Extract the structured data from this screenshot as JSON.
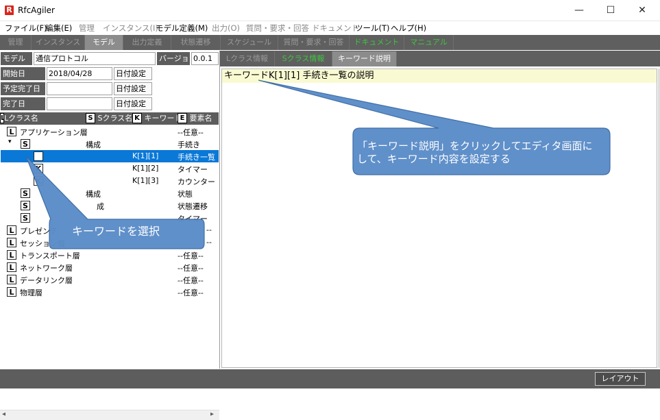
{
  "window": {
    "title": "RfcAgiler",
    "logo_letter": "R",
    "minimize": "—",
    "maximize": "☐",
    "close": "✕"
  },
  "menu": [
    {
      "label": "ファイル(F)",
      "enabled": true
    },
    {
      "label": "編集(E)",
      "enabled": true
    },
    {
      "label": "管理",
      "enabled": false
    },
    {
      "label": "インスタンス(I)",
      "enabled": false
    },
    {
      "label": "モデル定義(M)",
      "enabled": true
    },
    {
      "label": "出力(O)",
      "enabled": false
    },
    {
      "label": "質問・要求・回答",
      "enabled": false
    },
    {
      "label": "ドキュメント",
      "enabled": false
    },
    {
      "label": "ツール(T)",
      "enabled": true
    },
    {
      "label": "ヘルプ(H)",
      "enabled": true
    }
  ],
  "main_tabs": [
    {
      "label": "管理",
      "state": "normal"
    },
    {
      "label": "インスタンス",
      "state": "normal"
    },
    {
      "label": "モデル",
      "state": "active"
    },
    {
      "label": "出力定義",
      "state": "normal"
    },
    {
      "label": "状態遷移",
      "state": "normal"
    },
    {
      "label": "スケジュール",
      "state": "normal"
    },
    {
      "label": "質問・要求・回答",
      "state": "normal"
    },
    {
      "label": "ドキュメント",
      "state": "green"
    },
    {
      "label": "マニュアル",
      "state": "green"
    }
  ],
  "model_form": {
    "model_name_label": "モデル名",
    "model_name_value": "通信プロトコル",
    "version_label": "バージョン",
    "version_value": "0.0.1",
    "start_label": "開始日",
    "start_value": "2018/04/28",
    "planned_label": "予定完了日",
    "planned_value": "",
    "done_label": "完了日",
    "done_value": "",
    "date_button": "日付設定"
  },
  "tree_header": {
    "l_badge": "L",
    "l_label": "Lクラス名",
    "s_badge": "S",
    "s_label": "Sクラス名",
    "k_badge": "K",
    "k_label": "キーワード",
    "e_badge": "E",
    "e_label": "要素名"
  },
  "tree_rows": [
    {
      "badge": "L",
      "name": "アプリケーション層",
      "sclass": "",
      "keyword": "",
      "element": "--任意--",
      "selected": false
    },
    {
      "badge": "S",
      "expander": "▾",
      "name": "",
      "sclass": "構成",
      "keyword": "",
      "element": "手続き",
      "selected": false
    },
    {
      "badge": "K",
      "name": "",
      "sclass": "",
      "keyword": "K[1][1]",
      "element": "手続き一覧",
      "selected": true
    },
    {
      "badge": "K",
      "name": "",
      "sclass": "",
      "keyword": "K[1][2]",
      "element": "タイマー",
      "selected": false
    },
    {
      "badge": "K",
      "name": "",
      "sclass": "",
      "keyword": "K[1][3]",
      "element": "カウンター",
      "selected": false
    },
    {
      "badge": "S",
      "name": "",
      "sclass": "構成",
      "keyword": "",
      "element": "状態",
      "selected": false
    },
    {
      "badge": "S",
      "name": "",
      "sclass": "成",
      "keyword": "",
      "element": "状態遷移",
      "selected": false
    },
    {
      "badge": "S",
      "name": "",
      "sclass": "",
      "keyword": "",
      "element": "タイマー",
      "selected": false
    },
    {
      "badge": "L",
      "name": "プレゼンテ",
      "sclass": "",
      "keyword": "",
      "element": "--",
      "selected": false
    },
    {
      "badge": "L",
      "name": "セッション層",
      "sclass": "",
      "keyword": "",
      "element": "--",
      "selected": false
    },
    {
      "badge": "L",
      "name": "トランスポート層",
      "sclass": "",
      "keyword": "",
      "element": "--任意--",
      "selected": false
    },
    {
      "badge": "L",
      "name": "ネットワーク層",
      "sclass": "",
      "keyword": "",
      "element": "--任意--",
      "selected": false
    },
    {
      "badge": "L",
      "name": "データリンク層",
      "sclass": "",
      "keyword": "",
      "element": "--任意--",
      "selected": false
    },
    {
      "badge": "L",
      "name": "物理層",
      "sclass": "",
      "keyword": "",
      "element": "--任意--",
      "selected": false
    }
  ],
  "scroll": {
    "left_arrow": "◂",
    "right_arrow": "▸"
  },
  "right_tabs": [
    {
      "label": "Lクラス情報",
      "state": "normal"
    },
    {
      "label": "Sクラス情報",
      "state": "green"
    },
    {
      "label": "キーワード説明",
      "state": "active"
    }
  ],
  "editor": {
    "first_line": "キーワードK[1][1] 手続き一覧の説明"
  },
  "status": {
    "layout_button": "レイアウト"
  },
  "callouts": {
    "left": "キーワードを選択",
    "right": "「キーワード説明」をクリックしてエディタ画面に\nして、キーワード内容を設定する"
  },
  "colors": {
    "selection": "#0a78d7",
    "callout_fill": "#5b8dc9",
    "callout_stroke": "#3a6aa3",
    "editor_line_bg": "#fafad2",
    "tab_green": "#41c441"
  }
}
